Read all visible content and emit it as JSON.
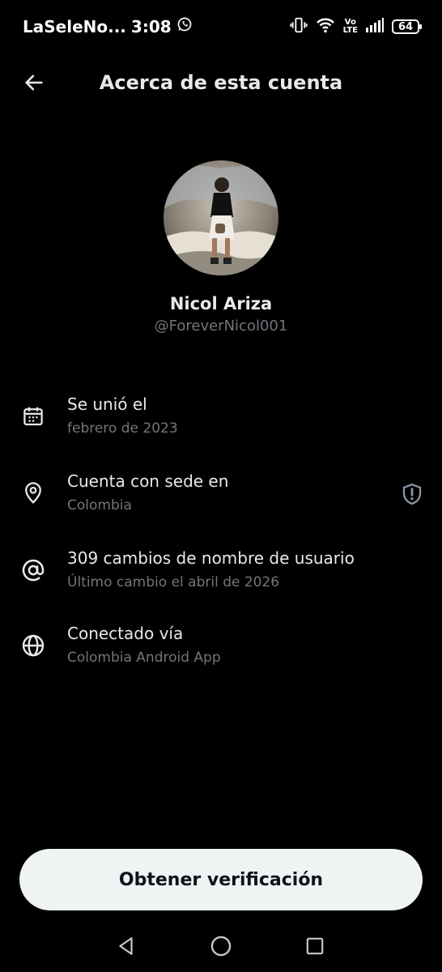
{
  "status_bar": {
    "carrier": "LaSeleNo...",
    "time": "3:08",
    "volte_top": "Vo",
    "volte_bottom": "LTE",
    "battery": "64"
  },
  "header": {
    "title": "Acerca de esta cuenta"
  },
  "profile": {
    "name": "Nicol Ariza",
    "handle": "@ForeverNicol001"
  },
  "info": [
    {
      "icon": "calendar-icon",
      "title": "Se unió el",
      "subtitle": "febrero de 2023"
    },
    {
      "icon": "location-pin-icon",
      "title": "Cuenta con sede en",
      "subtitle": "Colombia",
      "badge": "shield-alert-icon"
    },
    {
      "icon": "at-sign-icon",
      "title": "309 cambios de nombre de usuario",
      "subtitle": "Último cambio el abril de 2026"
    },
    {
      "icon": "globe-icon",
      "title": "Conectado vía",
      "subtitle": "Colombia Android App"
    }
  ],
  "actions": {
    "verify_label": "Obtener verificación"
  },
  "colors": {
    "background": "#000000",
    "primary_text": "#e7e9ea",
    "secondary_text": "#71767b",
    "button_bg": "#eff3f4",
    "button_text": "#0f1419"
  }
}
